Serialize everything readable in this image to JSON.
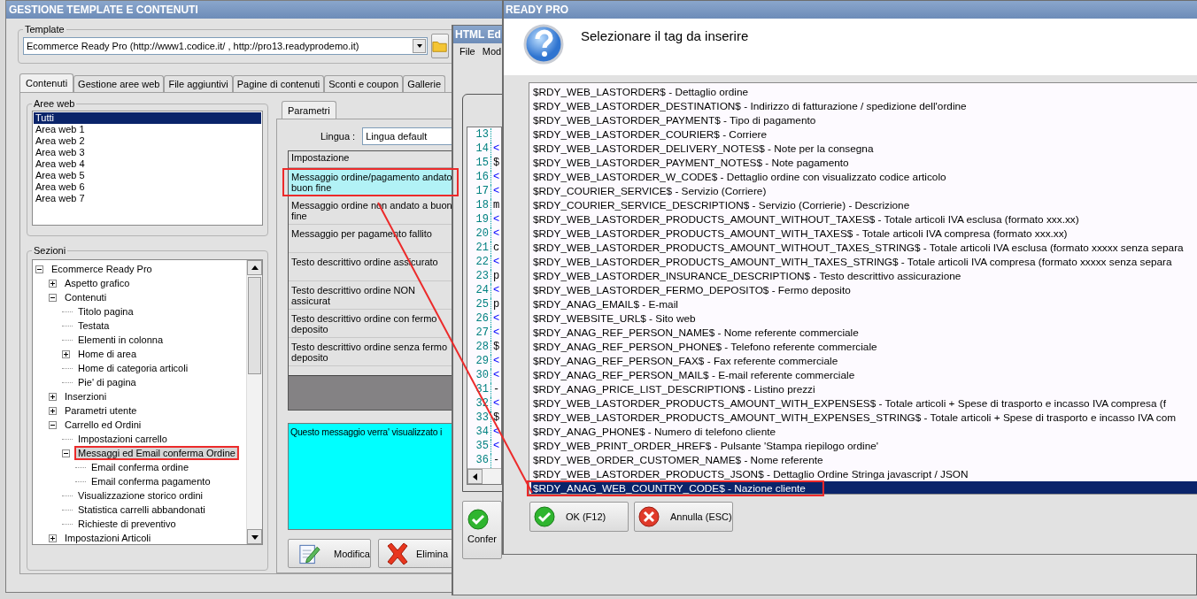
{
  "main_window": {
    "title": "GESTIONE TEMPLATE E CONTENUTI",
    "template": {
      "label": "Template",
      "value": "Ecommerce Ready Pro (http://www1.codice.it/ , http://pro13.readyprodemo.it)"
    },
    "tabs": [
      {
        "label": "Contenuti",
        "selected": true
      },
      {
        "label": "Gestione aree web",
        "selected": false
      },
      {
        "label": "File aggiuntivi",
        "selected": false
      },
      {
        "label": "Pagine di contenuti",
        "selected": false
      },
      {
        "label": "Sconti e coupon",
        "selected": false
      },
      {
        "label": "Gallerie",
        "selected": false
      }
    ],
    "aree_web": {
      "label": "Aree web",
      "items": [
        {
          "label": "Tutti",
          "selected": true
        },
        {
          "label": "Area web 1",
          "selected": false
        },
        {
          "label": "Area web 2",
          "selected": false
        },
        {
          "label": "Area web 3",
          "selected": false
        },
        {
          "label": "Area web 4",
          "selected": false
        },
        {
          "label": "Area web 5",
          "selected": false
        },
        {
          "label": "Area web 6",
          "selected": false
        },
        {
          "label": "Area web 7",
          "selected": false
        }
      ]
    },
    "sezioni": {
      "label": "Sezioni",
      "tree": [
        {
          "label": "Ecommerce Ready Pro",
          "expanded": true,
          "selected": false,
          "children": [
            {
              "label": "Aspetto grafico",
              "expanded": false,
              "selected": false
            },
            {
              "label": "Contenuti",
              "expanded": true,
              "selected": false,
              "children": [
                {
                  "label": "Titolo pagina",
                  "selected": false
                },
                {
                  "label": "Testata",
                  "selected": false
                },
                {
                  "label": "Elementi in colonna",
                  "selected": false
                },
                {
                  "label": "Home di area",
                  "expanded": false,
                  "selected": false
                },
                {
                  "label": "Home di categoria articoli",
                  "selected": false
                },
                {
                  "label": "Pie' di pagina",
                  "selected": false
                }
              ]
            },
            {
              "label": "Inserzioni",
              "expanded": false,
              "selected": false
            },
            {
              "label": "Parametri utente",
              "expanded": false,
              "selected": false
            },
            {
              "label": "Carrello ed Ordini",
              "expanded": true,
              "selected": false,
              "children": [
                {
                  "label": "Impostazioni carrello",
                  "selected": false
                },
                {
                  "label": "Messaggi ed Email conferma Ordine",
                  "expanded": true,
                  "selected": true,
                  "children": [
                    {
                      "label": "Email conferma ordine",
                      "selected": false
                    },
                    {
                      "label": "Email conferma pagamento",
                      "selected": false
                    }
                  ]
                },
                {
                  "label": "Visualizzazione storico ordini",
                  "selected": false
                },
                {
                  "label": "Statistica carrelli abbandonati",
                  "selected": false
                },
                {
                  "label": "Richieste di preventivo",
                  "selected": false
                }
              ]
            },
            {
              "label": "Impostazioni Articoli",
              "expanded": false,
              "selected": false
            }
          ]
        }
      ]
    },
    "parametri": {
      "tab": "Parametri",
      "lingua_label": "Lingua :",
      "lingua_value": "Lingua default",
      "column": "Impostazione",
      "rows": [
        {
          "label": "Messaggio ordine/pagamento andato buon fine",
          "selected": true
        },
        {
          "label": "Messaggio ordine non andato a buon fine",
          "selected": false
        },
        {
          "label": "Messaggio per pagamento fallito",
          "selected": false
        },
        {
          "label": "Testo descrittivo ordine assicurato",
          "selected": false
        },
        {
          "label": "Testo descrittivo ordine NON assicurat",
          "selected": false
        },
        {
          "label": "Testo descrittivo ordine con fermo deposito",
          "selected": false
        },
        {
          "label": "Testo descrittivo ordine senza fermo deposito",
          "selected": false
        }
      ],
      "description": "Questo messaggio verra' visualizzato i",
      "buttons": [
        {
          "label": "Modifica",
          "kind": "edit"
        },
        {
          "label": "Elimina",
          "kind": "delete"
        }
      ]
    }
  },
  "editor_window": {
    "title": "HTML Ed",
    "menu": [
      "File",
      "Mod"
    ],
    "lines": [
      {
        "number": "13"
      },
      {
        "number": "14",
        "text": "<",
        "kind": "tag"
      },
      {
        "number": "15",
        "text": "$",
        "kind": "text"
      },
      {
        "number": "16",
        "text": "<",
        "kind": "tag"
      },
      {
        "number": "17",
        "text": "<",
        "kind": "tag"
      },
      {
        "number": "18",
        "text": "m",
        "kind": "text"
      },
      {
        "number": "19",
        "text": "<",
        "kind": "tag"
      },
      {
        "number": "20",
        "text": "<",
        "kind": "tag"
      },
      {
        "number": "21",
        "text": "c",
        "kind": "text"
      },
      {
        "number": "22",
        "text": "<",
        "kind": "tag"
      },
      {
        "number": "23",
        "text": "p",
        "kind": "text"
      },
      {
        "number": "24",
        "text": "<",
        "kind": "tag"
      },
      {
        "number": "25",
        "text": "p",
        "kind": "text"
      },
      {
        "number": "26",
        "text": "<",
        "kind": "tag"
      },
      {
        "number": "27",
        "text": "<",
        "kind": "tag"
      },
      {
        "number": "28",
        "text": "$",
        "kind": "text"
      },
      {
        "number": "29",
        "text": "<",
        "kind": "tag"
      },
      {
        "number": "30",
        "text": "<",
        "kind": "tag"
      },
      {
        "number": "31",
        "text": "-",
        "kind": "text"
      },
      {
        "number": "32",
        "text": "<",
        "kind": "tag"
      },
      {
        "number": "33",
        "text": "$",
        "kind": "text"
      },
      {
        "number": "34",
        "text": "<",
        "kind": "tag"
      },
      {
        "number": "35",
        "text": "<",
        "kind": "tag"
      },
      {
        "number": "36",
        "text": "-",
        "kind": "text"
      }
    ],
    "button": "Confer"
  },
  "dialog": {
    "title": "READY PRO",
    "prompt": "Selezionare il tag da inserire",
    "items": [
      {
        "label": "$RDY_WEB_LASTORDER$ - Dettaglio ordine",
        "selected": false
      },
      {
        "label": "$RDY_WEB_LASTORDER_DESTINATION$ - Indirizzo di fatturazione / spedizione dell'ordine",
        "selected": false
      },
      {
        "label": "$RDY_WEB_LASTORDER_PAYMENT$ - Tipo di pagamento",
        "selected": false
      },
      {
        "label": "$RDY_WEB_LASTORDER_COURIER$ - Corriere",
        "selected": false
      },
      {
        "label": "$RDY_WEB_LASTORDER_DELIVERY_NOTES$ - Note per la consegna",
        "selected": false
      },
      {
        "label": "$RDY_WEB_LASTORDER_PAYMENT_NOTES$ - Note pagamento",
        "selected": false
      },
      {
        "label": "$RDY_WEB_LASTORDER_W_CODE$ - Dettaglio ordine con visualizzato codice articolo",
        "selected": false
      },
      {
        "label": "$RDY_COURIER_SERVICE$ - Servizio (Corriere)",
        "selected": false
      },
      {
        "label": "$RDY_COURIER_SERVICE_DESCRIPTION$ - Servizio (Corrierie) - Descrizione",
        "selected": false
      },
      {
        "label": "$RDY_WEB_LASTORDER_PRODUCTS_AMOUNT_WITHOUT_TAXES$ - Totale articoli IVA esclusa (formato xxx.xx)",
        "selected": false
      },
      {
        "label": "$RDY_WEB_LASTORDER_PRODUCTS_AMOUNT_WITH_TAXES$ - Totale articoli IVA compresa (formato xxx.xx)",
        "selected": false
      },
      {
        "label": "$RDY_WEB_LASTORDER_PRODUCTS_AMOUNT_WITHOUT_TAXES_STRING$ - Totale articoli IVA esclusa (formato xxxxx senza separa",
        "selected": false
      },
      {
        "label": "$RDY_WEB_LASTORDER_PRODUCTS_AMOUNT_WITH_TAXES_STRING$ - Totale articoli IVA compresa (formato xxxxx senza separa",
        "selected": false
      },
      {
        "label": "$RDY_WEB_LASTORDER_INSURANCE_DESCRIPTION$ - Testo descrittivo assicurazione",
        "selected": false
      },
      {
        "label": "$RDY_WEB_LASTORDER_FERMO_DEPOSITO$ - Fermo deposito",
        "selected": false
      },
      {
        "label": "$RDY_ANAG_EMAIL$ - E-mail",
        "selected": false
      },
      {
        "label": "$RDY_WEBSITE_URL$ - Sito web",
        "selected": false
      },
      {
        "label": "$RDY_ANAG_REF_PERSON_NAME$ - Nome referente commerciale",
        "selected": false
      },
      {
        "label": "$RDY_ANAG_REF_PERSON_PHONE$ - Telefono referente commerciale",
        "selected": false
      },
      {
        "label": "$RDY_ANAG_REF_PERSON_FAX$ - Fax referente commerciale",
        "selected": false
      },
      {
        "label": "$RDY_ANAG_REF_PERSON_MAIL$ - E-mail referente commerciale",
        "selected": false
      },
      {
        "label": "$RDY_ANAG_PRICE_LIST_DESCRIPTION$ - Listino prezzi",
        "selected": false
      },
      {
        "label": "$RDY_WEB_LASTORDER_PRODUCTS_AMOUNT_WITH_EXPENSES$ - Totale articoli + Spese di trasporto e incasso IVA compresa (f",
        "selected": false
      },
      {
        "label": "$RDY_WEB_LASTORDER_PRODUCTS_AMOUNT_WITH_EXPENSES_STRING$ - Totale articoli + Spese di trasporto e incasso IVA com",
        "selected": false
      },
      {
        "label": "$RDY_ANAG_PHONE$ - Numero di telefono cliente",
        "selected": false
      },
      {
        "label": "$RDY_WEB_PRINT_ORDER_HREF$ - Pulsante 'Stampa riepilogo ordine'",
        "selected": false
      },
      {
        "label": "$RDY_WEB_ORDER_CUSTOMER_NAME$ - Nome referente",
        "selected": false
      },
      {
        "label": "$RDY_WEB_LASTORDER_PRODUCTS_JSON$ - Dettaglio Ordine Stringa javascript / JSON",
        "selected": false
      },
      {
        "label": "$RDY_ANAG_WEB_COUNTRY_CODE$ - Nazione cliente",
        "selected": true
      }
    ],
    "buttons": [
      {
        "label": "OK (F12)",
        "kind": "ok"
      },
      {
        "label": "Annulla (ESC)",
        "kind": "cancel"
      }
    ]
  }
}
